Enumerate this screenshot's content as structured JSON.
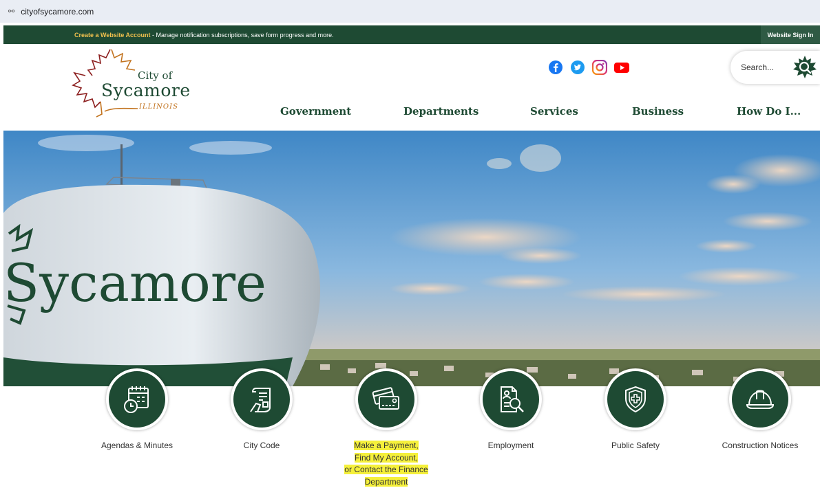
{
  "browser": {
    "url": "cityofsycamore.com"
  },
  "topbar": {
    "link_text": "Create a Website Account",
    "message": " - Manage notification subscriptions, save form progress and more.",
    "signin_label": "Website Sign In"
  },
  "logo": {
    "city_of": "City of",
    "name": "Sycamore",
    "state": "ILLINOIS"
  },
  "social": [
    "facebook-icon",
    "twitter-icon",
    "instagram-icon",
    "youtube-icon"
  ],
  "search": {
    "placeholder": "Search..."
  },
  "nav": {
    "items": [
      {
        "label": "Government"
      },
      {
        "label": "Departments"
      },
      {
        "label": "Services"
      },
      {
        "label": "Business"
      },
      {
        "label": "How Do I..."
      }
    ]
  },
  "hero": {
    "tower_text": "Sycamore"
  },
  "quick_links": [
    {
      "label": "Agendas & Minutes",
      "icon": "calendar-clock-icon"
    },
    {
      "label": "City Code",
      "icon": "scroll-document-icon"
    },
    {
      "lines": [
        "Make a Payment",
        "Find My Account",
        "or Contact the Finance",
        "Department"
      ],
      "icon": "credit-card-icon"
    },
    {
      "label": "Employment",
      "icon": "resume-search-icon"
    },
    {
      "label": "Public Safety",
      "icon": "shield-cross-icon"
    },
    {
      "label": "Construction Notices",
      "icon": "hard-hat-icon"
    }
  ],
  "colors": {
    "brand_green": "#1e4a33",
    "accent_orange": "#c2731f",
    "highlight": "#f5f03b"
  }
}
